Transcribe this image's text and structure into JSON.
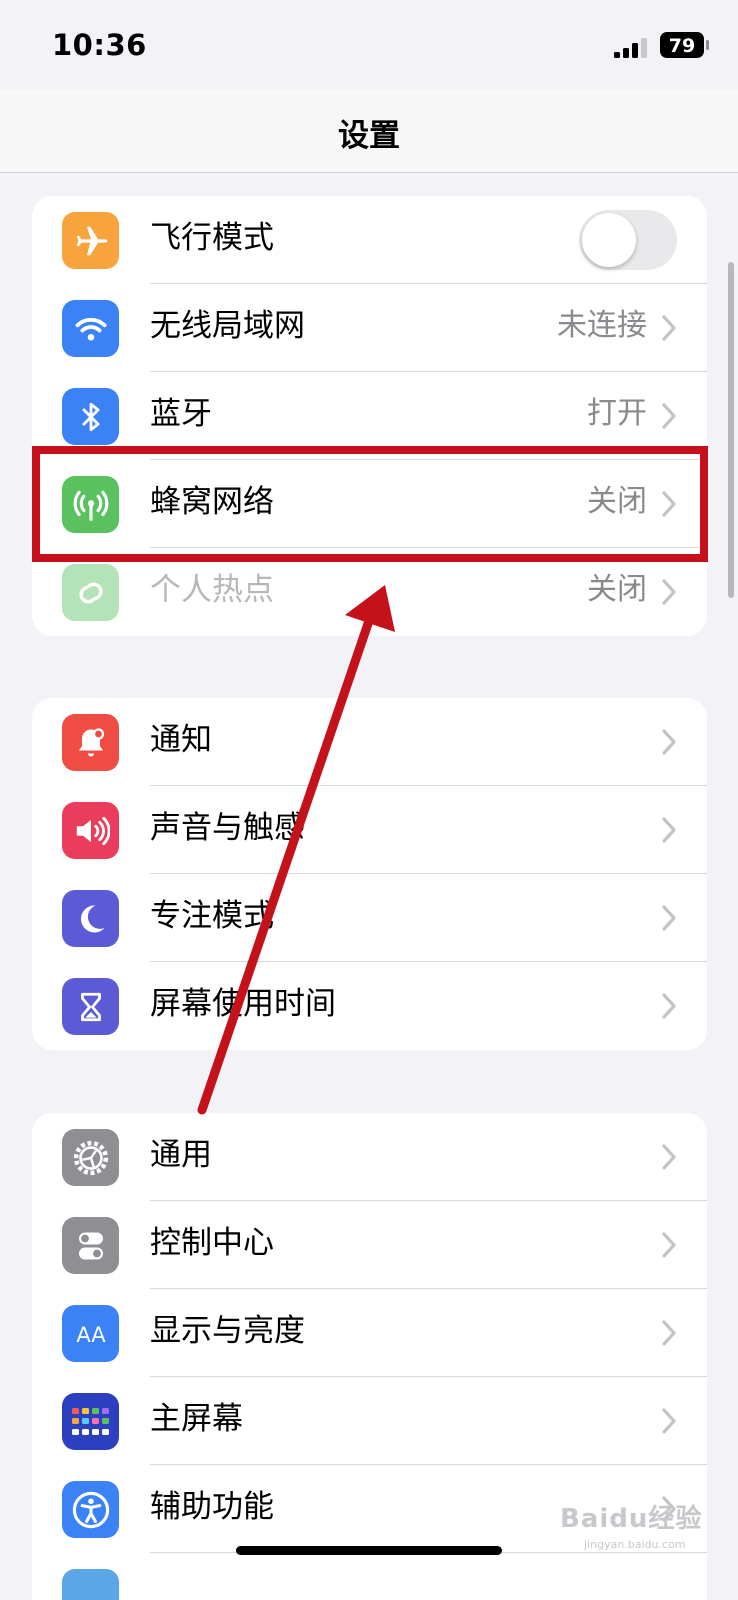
{
  "status_bar": {
    "time": "10:36",
    "battery": "79"
  },
  "nav": {
    "title": "设置"
  },
  "group1": [
    {
      "label": "飞行模式",
      "value": "",
      "icon": "airplane-icon",
      "color": "#f7a43c"
    },
    {
      "label": "无线局域网",
      "value": "未连接",
      "icon": "wifi-icon",
      "color": "#3a82f6"
    },
    {
      "label": "蓝牙",
      "value": "打开",
      "icon": "bluetooth-icon",
      "color": "#3a82f6"
    },
    {
      "label": "蜂窝网络",
      "value": "关闭",
      "icon": "antenna-icon",
      "color": "#5ac15f"
    },
    {
      "label": "个人热点",
      "value": "关闭",
      "icon": "hotspot-icon",
      "color": "#5ac15f"
    }
  ],
  "group2": [
    {
      "label": "通知",
      "icon": "bell-icon",
      "color": "#ef4d43"
    },
    {
      "label": "声音与触感",
      "icon": "speaker-icon",
      "color": "#ea3d5b"
    },
    {
      "label": "专注模式",
      "icon": "moon-icon",
      "color": "#5b5bd6"
    },
    {
      "label": "屏幕使用时间",
      "icon": "hourglass-icon",
      "color": "#5b5bd6"
    }
  ],
  "group3": [
    {
      "label": "通用",
      "icon": "gear-icon",
      "color": "#8e8e93"
    },
    {
      "label": "控制中心",
      "icon": "switches-icon",
      "color": "#8e8e93"
    },
    {
      "label": "显示与亮度",
      "icon": "text-size-icon",
      "color": "#3a82f6"
    },
    {
      "label": "主屏幕",
      "icon": "home-grid-icon",
      "color": "#3a52d6"
    },
    {
      "label": "辅助功能",
      "icon": "accessibility-icon",
      "color": "#3a82f6"
    }
  ],
  "annotation": {
    "color": "#c4111a"
  },
  "watermark": {
    "text": "Baidu经验",
    "sub": "jingyan.baidu.com"
  }
}
